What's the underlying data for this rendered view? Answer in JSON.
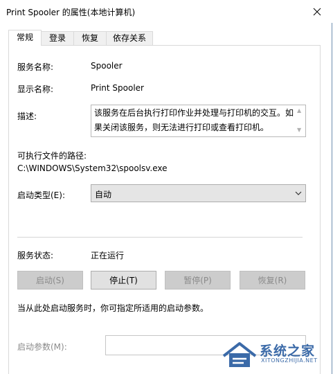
{
  "window": {
    "title": "Print Spooler 的属性(本地计算机)"
  },
  "tabs": [
    {
      "label": "常规",
      "active": true
    },
    {
      "label": "登录",
      "active": false
    },
    {
      "label": "恢复",
      "active": false
    },
    {
      "label": "依存关系",
      "active": false
    }
  ],
  "general": {
    "service_name_label": "服务名称:",
    "service_name_value": "Spooler",
    "display_name_label": "显示名称:",
    "display_name_value": "Print Spooler",
    "description_label": "描述:",
    "description_value": "该服务在后台执行打印作业并处理与打印机的交互。如果关闭该服务，则无法进行打印或查看打印机。",
    "path_label": "可执行文件的路径:",
    "path_value": "C:\\WINDOWS\\System32\\spoolsv.exe",
    "startup_type_label": "启动类型(E):",
    "startup_type_value": "自动",
    "status_label": "服务状态:",
    "status_value": "正在运行",
    "buttons": {
      "start": "启动(S)",
      "stop": "停止(T)",
      "pause": "暂停(P)",
      "resume": "恢复(R)"
    },
    "hint_text": "当从此处启动服务时，你可指定所适用的启动参数。",
    "params_label": "启动参数(M):",
    "params_value": ""
  },
  "watermark": {
    "title": "系统之家",
    "subtitle": "XITONGZHIJIA.NET"
  },
  "colors": {
    "disabled_text": "#8a8a8a",
    "button_bg": "#e1e1e1",
    "watermark": "#3b6aa8"
  }
}
